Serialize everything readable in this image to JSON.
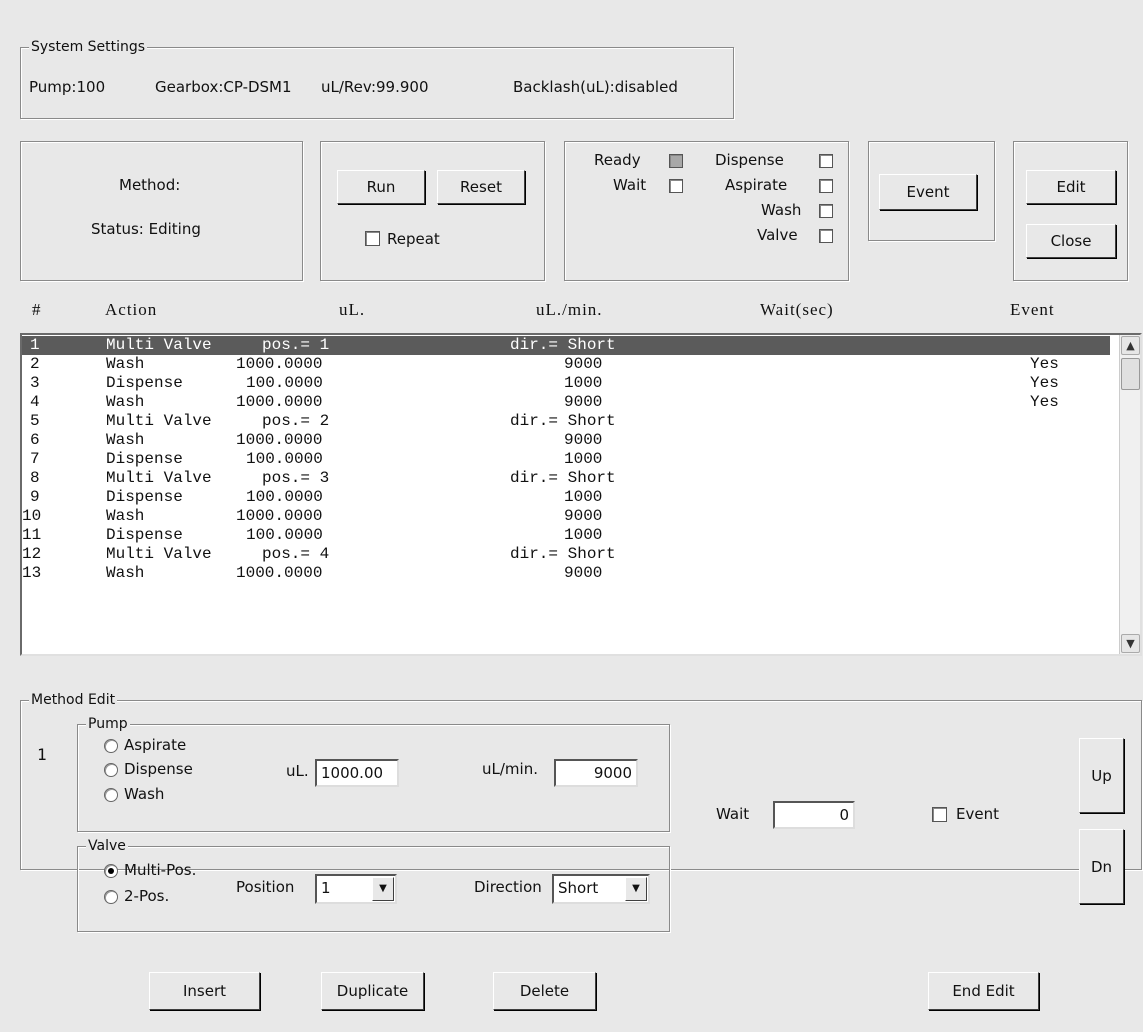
{
  "system": {
    "legend": "System Settings",
    "pump": "Pump:100",
    "gearbox": "Gearbox:CP-DSM1",
    "ul_rev": "uL/Rev:99.900",
    "backlash": "Backlash(uL):disabled"
  },
  "method": {
    "label": "Method:",
    "status": "Status: Editing"
  },
  "controls": {
    "run": "Run",
    "reset": "Reset",
    "repeat": "Repeat"
  },
  "indicators": {
    "ready": "Ready",
    "wait": "Wait",
    "dispense": "Dispense",
    "aspirate": "Aspirate",
    "wash": "Wash",
    "valve": "Valve"
  },
  "event_button": "Event",
  "edit_button": "Edit",
  "close_button": "Close",
  "columns": [
    "#",
    "Action",
    "uL.",
    "uL./min.",
    "Wait(sec)",
    "Event"
  ],
  "rows": [
    {
      "n": "1",
      "action": "Multi Valve",
      "ul": "pos.= 1",
      "rate": "dir.= Short",
      "event": ""
    },
    {
      "n": "2",
      "action": "Wash",
      "ul": "1000.0000",
      "rate": "9000",
      "event": "Yes"
    },
    {
      "n": "3",
      "action": "Dispense",
      "ul": "100.0000",
      "rate": "1000",
      "event": "Yes"
    },
    {
      "n": "4",
      "action": "Wash",
      "ul": "1000.0000",
      "rate": "9000",
      "event": "Yes"
    },
    {
      "n": "5",
      "action": "Multi Valve",
      "ul": "pos.= 2",
      "rate": "dir.= Short",
      "event": ""
    },
    {
      "n": "6",
      "action": "Wash",
      "ul": "1000.0000",
      "rate": "9000",
      "event": ""
    },
    {
      "n": "7",
      "action": "Dispense",
      "ul": "100.0000",
      "rate": "1000",
      "event": ""
    },
    {
      "n": "8",
      "action": "Multi Valve",
      "ul": "pos.= 3",
      "rate": "dir.= Short",
      "event": ""
    },
    {
      "n": "9",
      "action": "Dispense",
      "ul": "100.0000",
      "rate": "1000",
      "event": ""
    },
    {
      "n": "10",
      "action": "Wash",
      "ul": "1000.0000",
      "rate": "9000",
      "event": ""
    },
    {
      "n": "11",
      "action": "Dispense",
      "ul": "100.0000",
      "rate": "1000",
      "event": ""
    },
    {
      "n": "12",
      "action": "Multi Valve",
      "ul": "pos.= 4",
      "rate": "dir.= Short",
      "event": ""
    },
    {
      "n": "13",
      "action": "Wash",
      "ul": "1000.0000",
      "rate": "9000",
      "event": ""
    }
  ],
  "method_edit": {
    "legend": "Method Edit",
    "index": "1",
    "pump_legend": "Pump",
    "aspirate": "Aspirate",
    "dispense": "Dispense",
    "wash": "Wash",
    "ul_label": "uL.",
    "ul_value": "1000.00",
    "rate_label": "uL/min.",
    "rate_value": "9000",
    "valve_legend": "Valve",
    "multi_pos": "Multi-Pos.",
    "two_pos": "2-Pos.",
    "position_label": "Position",
    "position_value": "1",
    "direction_label": "Direction",
    "direction_value": "Short",
    "wait_label": "Wait",
    "wait_value": "0",
    "event_label": "Event",
    "up": "Up",
    "dn": "Dn"
  },
  "bottom": {
    "insert": "Insert",
    "duplicate": "Duplicate",
    "delete": "Delete",
    "end_edit": "End Edit"
  }
}
